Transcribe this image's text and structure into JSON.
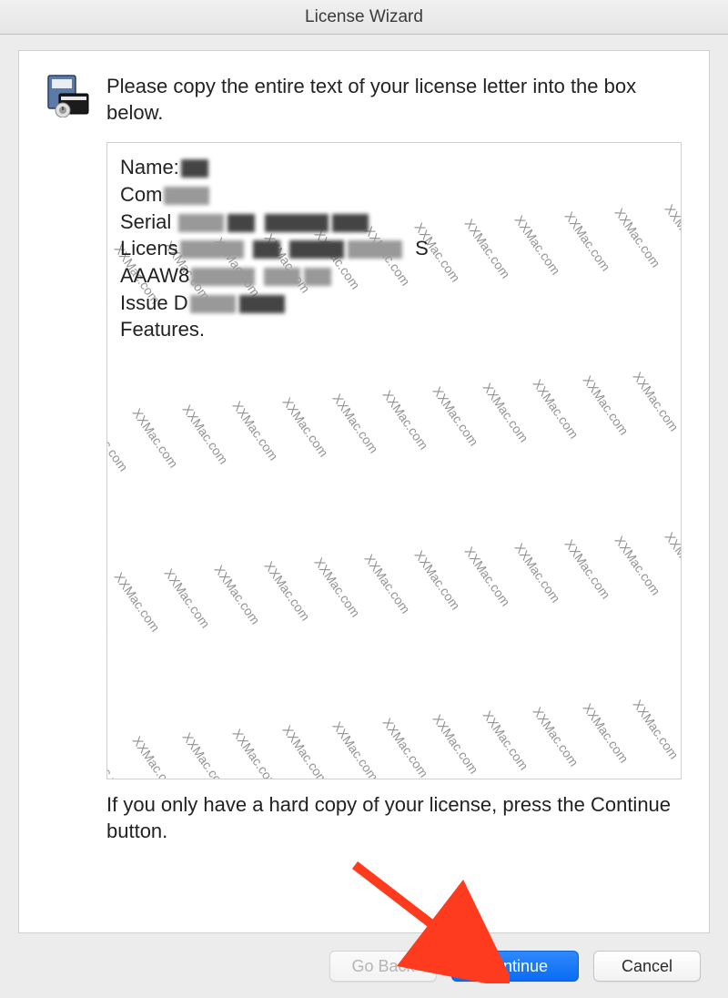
{
  "window": {
    "title": "License Wizard"
  },
  "content": {
    "instruction": "Please copy the entire text of your license letter into the box below.",
    "licenseLines": {
      "l1": "Name:",
      "l2": "Com",
      "l3": "Serial",
      "l4": "Licens",
      "l4_tail": "S",
      "l5": "AAAW8",
      "l6": "Issue D",
      "l7": "Features."
    },
    "bottomInstruction": "If you only have a hard copy of your license, press the Continue button."
  },
  "buttons": {
    "goBack": "Go Back",
    "continue": "Continue",
    "cancel": "Cancel"
  },
  "watermarkText": "XXMac.com"
}
